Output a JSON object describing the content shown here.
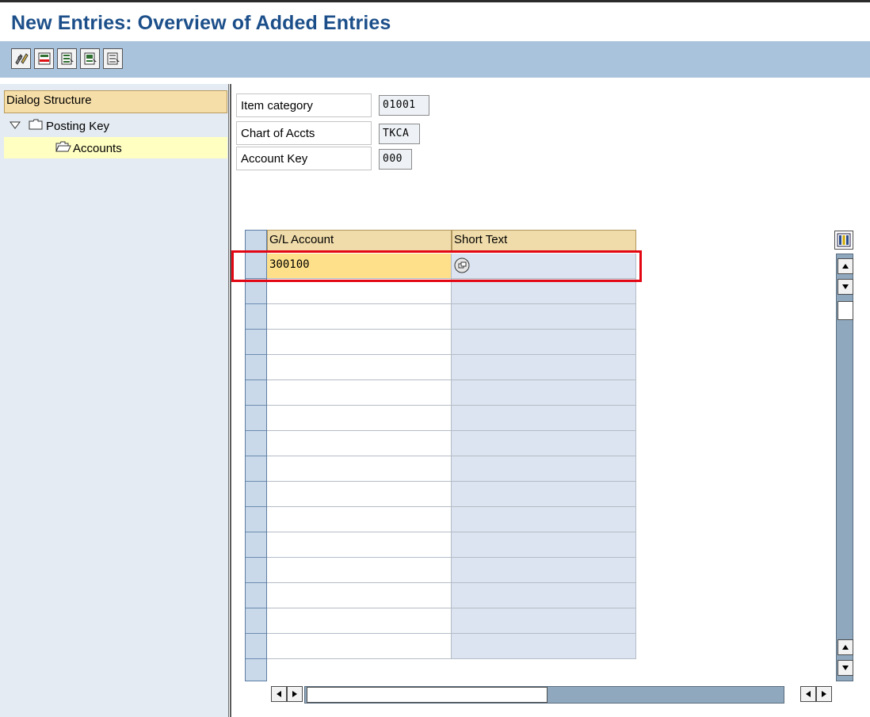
{
  "window": {
    "title": "New Entries: Overview of Added Entries"
  },
  "toolbar": {
    "buttons": [
      {
        "name": "change-display-icon"
      },
      {
        "name": "delete-row-icon"
      },
      {
        "name": "select-all-icon"
      },
      {
        "name": "select-block-icon"
      },
      {
        "name": "deselect-all-icon"
      }
    ]
  },
  "dialog_structure": {
    "header": "Dialog Structure",
    "tree": [
      {
        "label": "Posting Key",
        "icon": "folder-icon",
        "expanded": true
      },
      {
        "label": "Accounts",
        "icon": "open-folder-icon",
        "selected": true
      }
    ]
  },
  "fields": [
    {
      "label": "Item category",
      "value": "01001"
    },
    {
      "label": "Chart of Accts",
      "value": "TKCA"
    },
    {
      "label": "Account Key",
      "value": "000"
    }
  ],
  "table": {
    "columns": [
      "G/L Account",
      "Short Text"
    ],
    "rows": [
      {
        "gl_account": "300100",
        "short_text": ""
      }
    ],
    "empty_rows": 15,
    "colors": {
      "highlight": "#ffe08a",
      "short_text_bg": "#dbe4f0",
      "input_bg": "#ffffff"
    }
  },
  "annotation": {
    "color": "#e30613"
  }
}
